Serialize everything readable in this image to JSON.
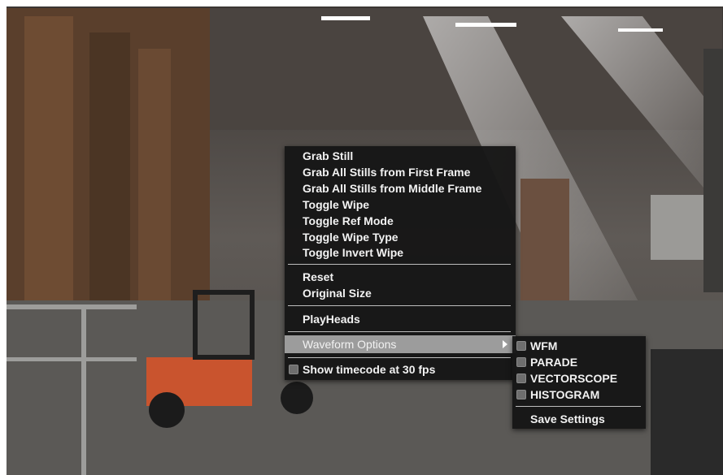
{
  "context_menu": {
    "items_group1": [
      "Grab Still",
      "Grab All Stills from First Frame",
      "Grab All Stills from Middle Frame",
      "Toggle Wipe",
      "Toggle Ref Mode",
      "Toggle Wipe Type",
      "Toggle Invert Wipe"
    ],
    "items_group2": [
      "Reset",
      "Original Size"
    ],
    "playheads": "PlayHeads",
    "waveform_options": "Waveform Options",
    "show_timecode": "Show timecode at 30 fps"
  },
  "waveform_submenu": {
    "options": [
      "WFM",
      "PARADE",
      "VECTORSCOPE",
      "HISTOGRAM"
    ],
    "save_settings": "Save Settings"
  },
  "colors": {
    "menu_bg": "#161616",
    "highlight": "#9c9c9c",
    "text": "#f2f2f2"
  }
}
